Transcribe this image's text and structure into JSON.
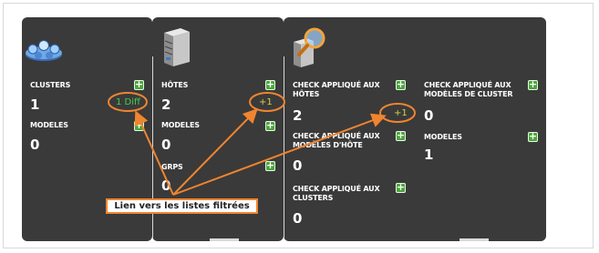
{
  "panels": {
    "clusters": {
      "icon": "clusters-icon",
      "clusters_label": "CLUSTERS",
      "clusters_value": "1",
      "clusters_diff": "1 Diff",
      "modeles_label": "MODELES",
      "modeles_value": "0"
    },
    "hotes": {
      "icon": "server-icon",
      "hotes_label": "HÔTES",
      "hotes_value": "2",
      "hotes_diff": "+1",
      "modeles_label": "MODELES",
      "modeles_value": "0",
      "grps_label": "GRPS",
      "grps_value": "0"
    },
    "checks": {
      "icon": "magnifier-server-icon",
      "left": {
        "hotes_label": "CHECK APPLIQUÉ AUX HÔTES",
        "hotes_value": "2",
        "hotes_diff": "+1",
        "modeles_label": "CHECK APPLIQUÉ AUX MODÈLES D'HÔTE",
        "modeles_value": "0",
        "clusters_label": "CHECK APPLIQUÉ AUX CLUSTERS",
        "clusters_value": "0"
      },
      "right": {
        "modeles_cluster_label": "CHECK APPLIQUÉ AUX MODÈLES DE CLUSTER",
        "modeles_cluster_value": "0",
        "modeles_label": "MODELES",
        "modeles_value": "1"
      }
    }
  },
  "annotation": {
    "tooltip": "Lien vers les listes filtrées",
    "color": "#f0852f"
  },
  "colors": {
    "panel_bg": "#3a3a3a",
    "plus_button": "#4aa53a",
    "diff_green": "#3fd24a",
    "diff_yellow": "#d3d145"
  }
}
